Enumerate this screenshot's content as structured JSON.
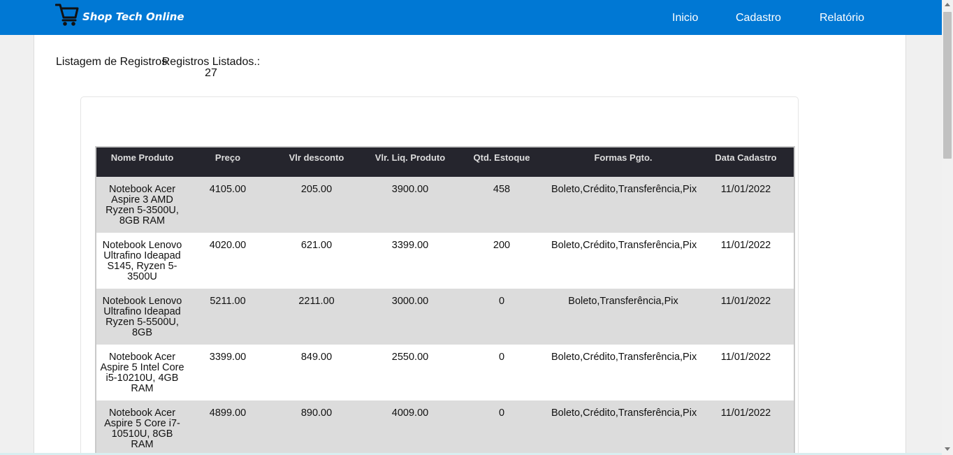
{
  "brand": {
    "name": "Shop Tech Online",
    "icon": "shopping-cart-icon"
  },
  "nav": {
    "items": [
      "Inicio",
      "Cadastro",
      "Relatório"
    ]
  },
  "page": {
    "heading": "Listagem de Registros",
    "count_label": "Registros Listados.:",
    "count_value": "27"
  },
  "table": {
    "headers": [
      "Nome Produto",
      "Preço",
      "Vlr desconto",
      "Vlr. Liq. Produto",
      "Qtd. Estoque",
      "Formas Pgto.",
      "Data Cadastro"
    ],
    "rows": [
      [
        "Notebook Acer Aspire 3 AMD Ryzen 5-3500U, 8GB RAM",
        "4105.00",
        "205.00",
        "3900.00",
        "458",
        "Boleto,Crédito,Transferência,Pix",
        "11/01/2022"
      ],
      [
        "Notebook Lenovo Ultrafino Ideapad S145, Ryzen 5-3500U",
        "4020.00",
        "621.00",
        "3399.00",
        "200",
        "Boleto,Crédito,Transferência,Pix",
        "11/01/2022"
      ],
      [
        "Notebook Lenovo Ultrafino Ideapad Ryzen 5-5500U, 8GB",
        "5211.00",
        "2211.00",
        "3000.00",
        "0",
        "Boleto,Transferência,Pix",
        "11/01/2022"
      ],
      [
        "Notebook Acer Aspire 5 Intel Core i5-10210U, 4GB RAM",
        "3399.00",
        "849.00",
        "2550.00",
        "0",
        "Boleto,Crédito,Transferência,Pix",
        "11/01/2022"
      ],
      [
        "Notebook Acer Aspire 5 Core i7-10510U, 8GB RAM",
        "4899.00",
        "890.00",
        "4009.00",
        "0",
        "Boleto,Crédito,Transferência,Pix",
        "11/01/2022"
      ]
    ]
  },
  "colors": {
    "navbar": "#0078d4",
    "header_bg": "#25252d",
    "row_alt": "#dcdcdc"
  }
}
